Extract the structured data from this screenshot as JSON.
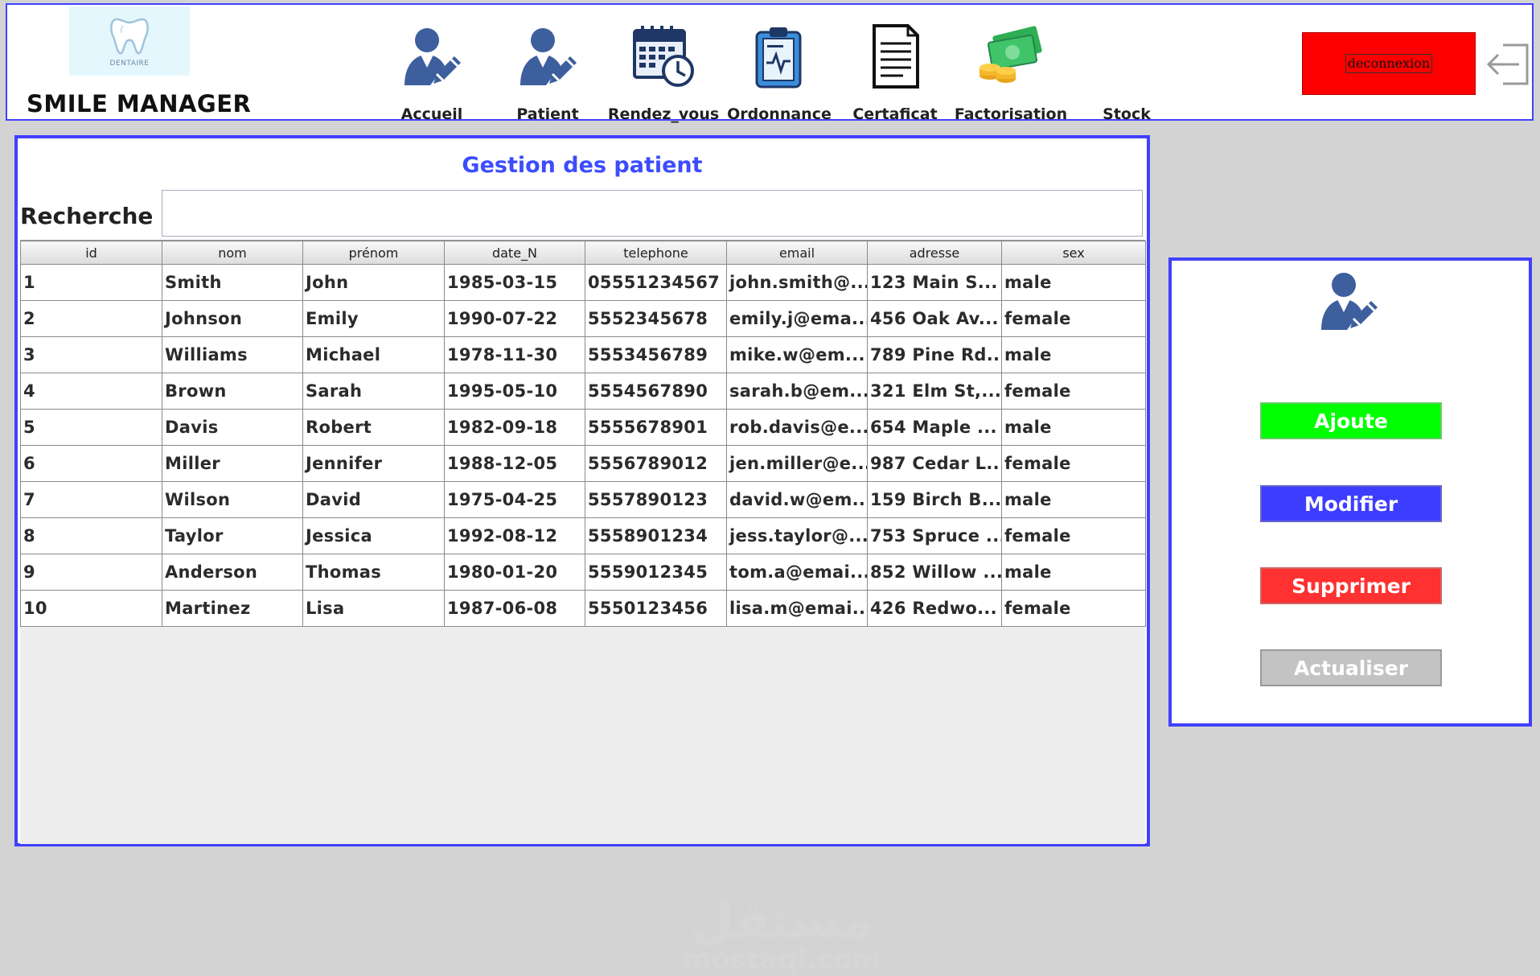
{
  "header": {
    "app_title": "SMILE MANAGER",
    "logo_text": "DENTAIRE",
    "nav": [
      {
        "label": "Accueil",
        "icon": "user-edit-icon"
      },
      {
        "label": "Patient",
        "icon": "user-edit-icon"
      },
      {
        "label": "Rendez_vous",
        "icon": "calendar-clock-icon"
      },
      {
        "label": "Ordonnance",
        "icon": "clipboard-icon"
      },
      {
        "label": "Certaficat",
        "icon": "document-icon"
      },
      {
        "label": "Factorisation",
        "icon": "money-icon"
      },
      {
        "label": "Stock",
        "icon": ""
      }
    ],
    "logout_label": "deconnexion"
  },
  "main": {
    "title": "Gestion des patient",
    "search_label": "Recherche :",
    "search_value": "",
    "columns": [
      "id",
      "nom",
      "prénom",
      "date_N",
      "telephone",
      "email",
      "adresse",
      "sex"
    ],
    "rows": [
      [
        "1",
        "Smith",
        "John",
        "1985-03-15",
        "05551234567",
        "john.smith@...",
        "123 Main S...",
        "male"
      ],
      [
        "2",
        "Johnson",
        "Emily",
        "1990-07-22",
        "5552345678",
        "emily.j@ema...",
        "456 Oak Av...",
        "female"
      ],
      [
        "3",
        "Williams",
        "Michael",
        "1978-11-30",
        "5553456789",
        "mike.w@em...",
        "789 Pine Rd...",
        "male"
      ],
      [
        "4",
        "Brown",
        "Sarah",
        "1995-05-10",
        "5554567890",
        "sarah.b@em...",
        "321 Elm St,...",
        "female"
      ],
      [
        "5",
        "Davis",
        "Robert",
        "1982-09-18",
        "5555678901",
        "rob.davis@e...",
        "654 Maple ...",
        "male"
      ],
      [
        "6",
        "Miller",
        "Jennifer",
        "1988-12-05",
        "5556789012",
        "jen.miller@e...",
        "987 Cedar L...",
        "female"
      ],
      [
        "7",
        "Wilson",
        "David",
        "1975-04-25",
        "5557890123",
        "david.w@em...",
        "159 Birch B...",
        "male"
      ],
      [
        "8",
        "Taylor",
        "Jessica",
        "1992-08-12",
        "5558901234",
        "jess.taylor@...",
        "753 Spruce ...",
        "female"
      ],
      [
        "9",
        "Anderson",
        "Thomas",
        "1980-01-20",
        "5559012345",
        "tom.a@emai...",
        "852 Willow ...",
        "male"
      ],
      [
        "10",
        "Martinez",
        "Lisa",
        "1987-06-08",
        "5550123456",
        "lisa.m@emai...",
        "426 Redwo...",
        "female"
      ]
    ]
  },
  "side": {
    "buttons": {
      "ajoute": "Ajoute",
      "modifier": "Modifier",
      "supprimer": "Supprimer",
      "actualiser": "Actualiser"
    }
  },
  "watermark": {
    "arabic": "مستقل",
    "latin": "mostaql.com"
  },
  "colors": {
    "accent": "#4040ff",
    "title": "#3c4cff",
    "logout": "#ff0000",
    "ajoute": "#00ff00",
    "modifier": "#3d3dff",
    "supprimer": "#ff3131",
    "actualiser": "#c3c3c3"
  }
}
